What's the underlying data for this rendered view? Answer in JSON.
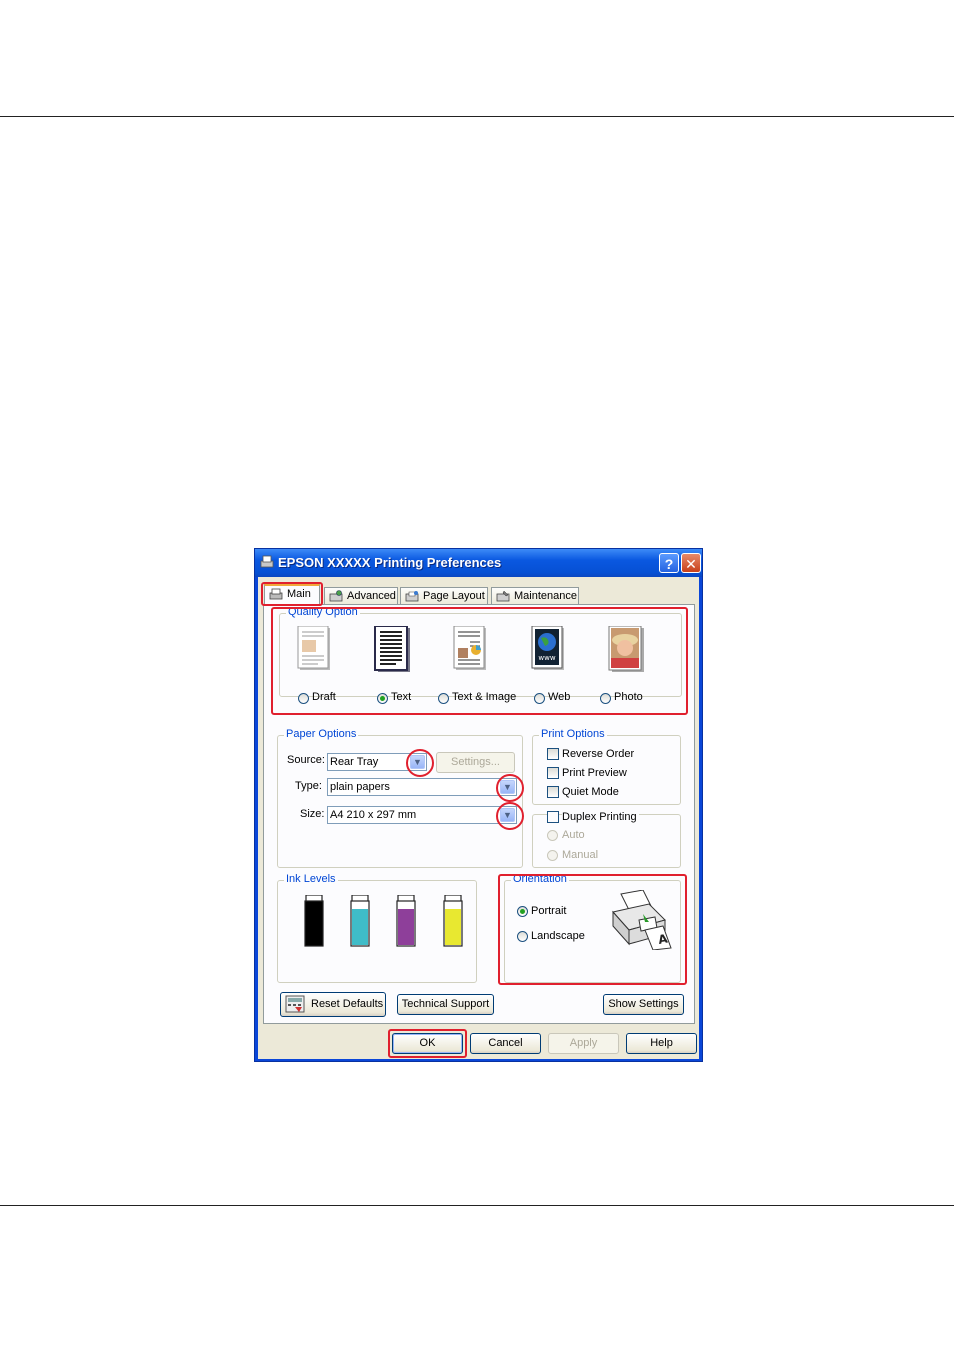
{
  "window": {
    "title": "EPSON  XXXXX  Printing Preferences",
    "help_label": "?",
    "close_label": "✕"
  },
  "tabs": [
    {
      "label": "Main",
      "icon": "printer-icon",
      "active": true
    },
    {
      "label": "Advanced",
      "icon": "advanced-icon",
      "active": false
    },
    {
      "label": "Page Layout",
      "icon": "page-layout-icon",
      "active": false
    },
    {
      "label": "Maintenance",
      "icon": "maintenance-icon",
      "active": false
    }
  ],
  "quality_option": {
    "group_label": "Quality Option",
    "options": [
      {
        "label": "Draft",
        "icon": "draft-page-icon",
        "selected": false
      },
      {
        "label": "Text",
        "icon": "text-page-icon",
        "selected": true
      },
      {
        "label": "Text & Image",
        "icon": "text-image-page-icon",
        "selected": false
      },
      {
        "label": "Web",
        "icon": "web-page-icon",
        "selected": false
      },
      {
        "label": "Photo",
        "icon": "photo-page-icon",
        "selected": false
      }
    ]
  },
  "paper_options": {
    "group_label": "Paper Options",
    "source_label": "Source:",
    "source_value": "Rear Tray",
    "settings_button": "Settings...",
    "type_label": "Type:",
    "type_value": "plain papers",
    "size_label": "Size:",
    "size_value": "A4 210 x 297 mm"
  },
  "print_options": {
    "group_label": "Print Options",
    "reverse_order": "Reverse Order",
    "print_preview": "Print Preview",
    "quiet_mode": "Quiet Mode"
  },
  "duplex": {
    "label": "Duplex Printing",
    "auto": "Auto",
    "manual": "Manual"
  },
  "ink_levels": {
    "group_label": "Ink Levels",
    "cartridges": [
      {
        "name": "black",
        "color": "#000000"
      },
      {
        "name": "cyan",
        "color": "#3fbcc8"
      },
      {
        "name": "magenta",
        "color": "#8e3f9a"
      },
      {
        "name": "yellow",
        "color": "#e8e830"
      }
    ]
  },
  "orientation": {
    "group_label": "Orientation",
    "portrait": "Portrait",
    "landscape": "Landscape",
    "selected": "Portrait"
  },
  "bottom_buttons": {
    "reset_defaults": "Reset Defaults",
    "technical_support": "Technical Support",
    "show_settings": "Show Settings"
  },
  "dialog_buttons": {
    "ok": "OK",
    "cancel": "Cancel",
    "apply": "Apply",
    "help": "Help"
  },
  "colors": {
    "title_bar": "#0a58e0",
    "highlight": "#e0202e",
    "group_label": "#0046d5"
  }
}
